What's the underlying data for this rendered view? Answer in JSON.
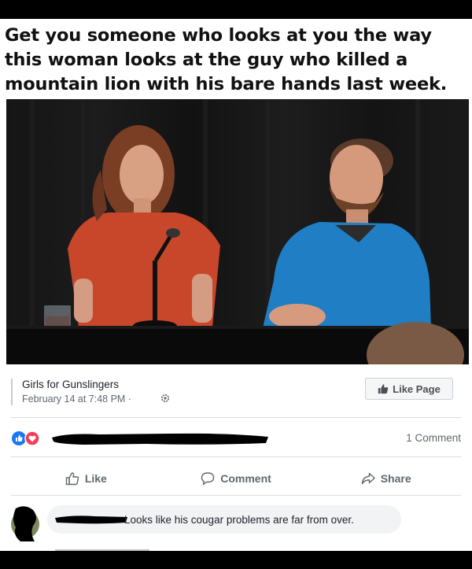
{
  "post": {
    "caption": "Get you someone who looks at you the way this woman looks at the guy who killed a mountain lion with his bare hands last week.",
    "page_name": "Girls for Gunslingers",
    "date": "February 14 at 7:48 PM ·",
    "like_page_label": "Like Page",
    "comment_count": "1 Comment"
  },
  "actions": {
    "like": "Like",
    "comment": "Comment",
    "share": "Share"
  },
  "comment": {
    "text": "Looks like his cougar problems are far from over."
  },
  "icons": {
    "privacy": "gear-icon",
    "like_page": "thumbs-up-icon",
    "reactions": [
      "like-reaction-icon",
      "love-reaction-icon"
    ],
    "like": "thumbs-up-icon",
    "comment": "speech-bubble-icon",
    "share": "share-arrow-icon"
  },
  "colors": {
    "like_blue": "#1877f2",
    "love_red": "#f33e58",
    "secondary_text": "#606770"
  }
}
